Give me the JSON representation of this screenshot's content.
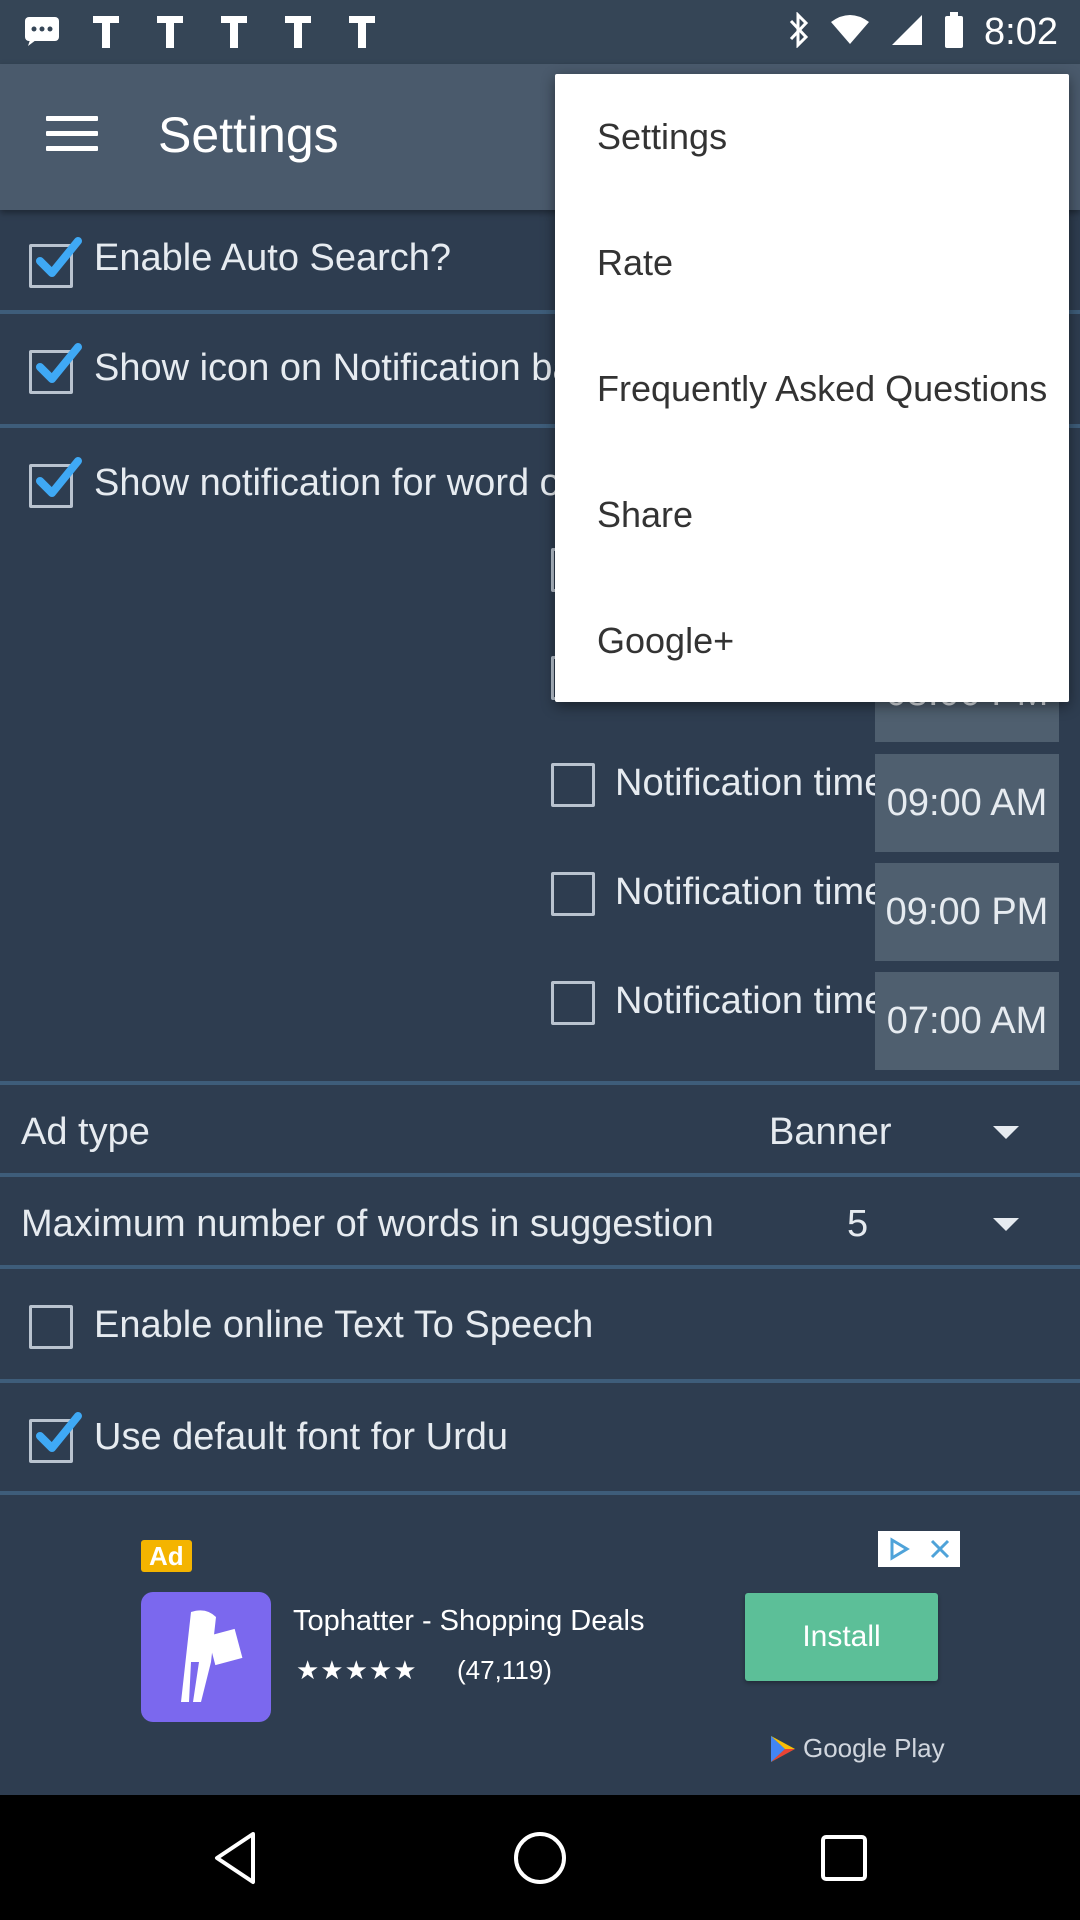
{
  "status_bar": {
    "time": "8:02",
    "left_icons": [
      "messages-icon",
      "app-notification-icon",
      "app-notification-icon",
      "app-notification-icon",
      "app-notification-icon",
      "app-notification-icon"
    ],
    "right_icons": [
      "bluetooth-icon",
      "wifi-icon",
      "signal-icon",
      "battery-icon"
    ]
  },
  "app_bar": {
    "title": "Settings"
  },
  "settings": {
    "auto_search": {
      "label": "Enable Auto Search?",
      "checked": true
    },
    "notif_icon": {
      "label": "Show icon on Notification bar",
      "checked": true
    },
    "word_of_day": {
      "label": "Show notification for word of th",
      "checked": true
    },
    "notification_times": [
      {
        "label": "Notification time",
        "time": "09:00 AM",
        "checked": false
      },
      {
        "label": "Notification time",
        "time": "09:00 PM",
        "checked": false
      },
      {
        "label": "Notification time",
        "time": "07:00 AM",
        "checked": false
      }
    ],
    "partial_time": "08:00 PM",
    "ad_type": {
      "label": "Ad type",
      "value": "Banner"
    },
    "max_words": {
      "label": "Maximum number of words in suggestion",
      "value": "5"
    },
    "online_tts": {
      "label": "Enable online Text To Speech",
      "checked": false
    },
    "urdu_font": {
      "label": "Use default font for Urdu",
      "checked": true
    }
  },
  "menu": {
    "items": [
      "Settings",
      "Rate",
      "Frequently Asked Questions",
      "Share",
      "Google+"
    ]
  },
  "ad": {
    "badge": "Ad",
    "title": "Tophatter - Shopping Deals",
    "stars": "★★★★★",
    "rating": "(47,119)",
    "install": "Install",
    "store": "Google Play"
  },
  "colors": {
    "background": "#2e3d50",
    "app_bar": "#4a5a6c",
    "check_accent": "#3fa9f5",
    "install_button": "#5cbf98"
  }
}
